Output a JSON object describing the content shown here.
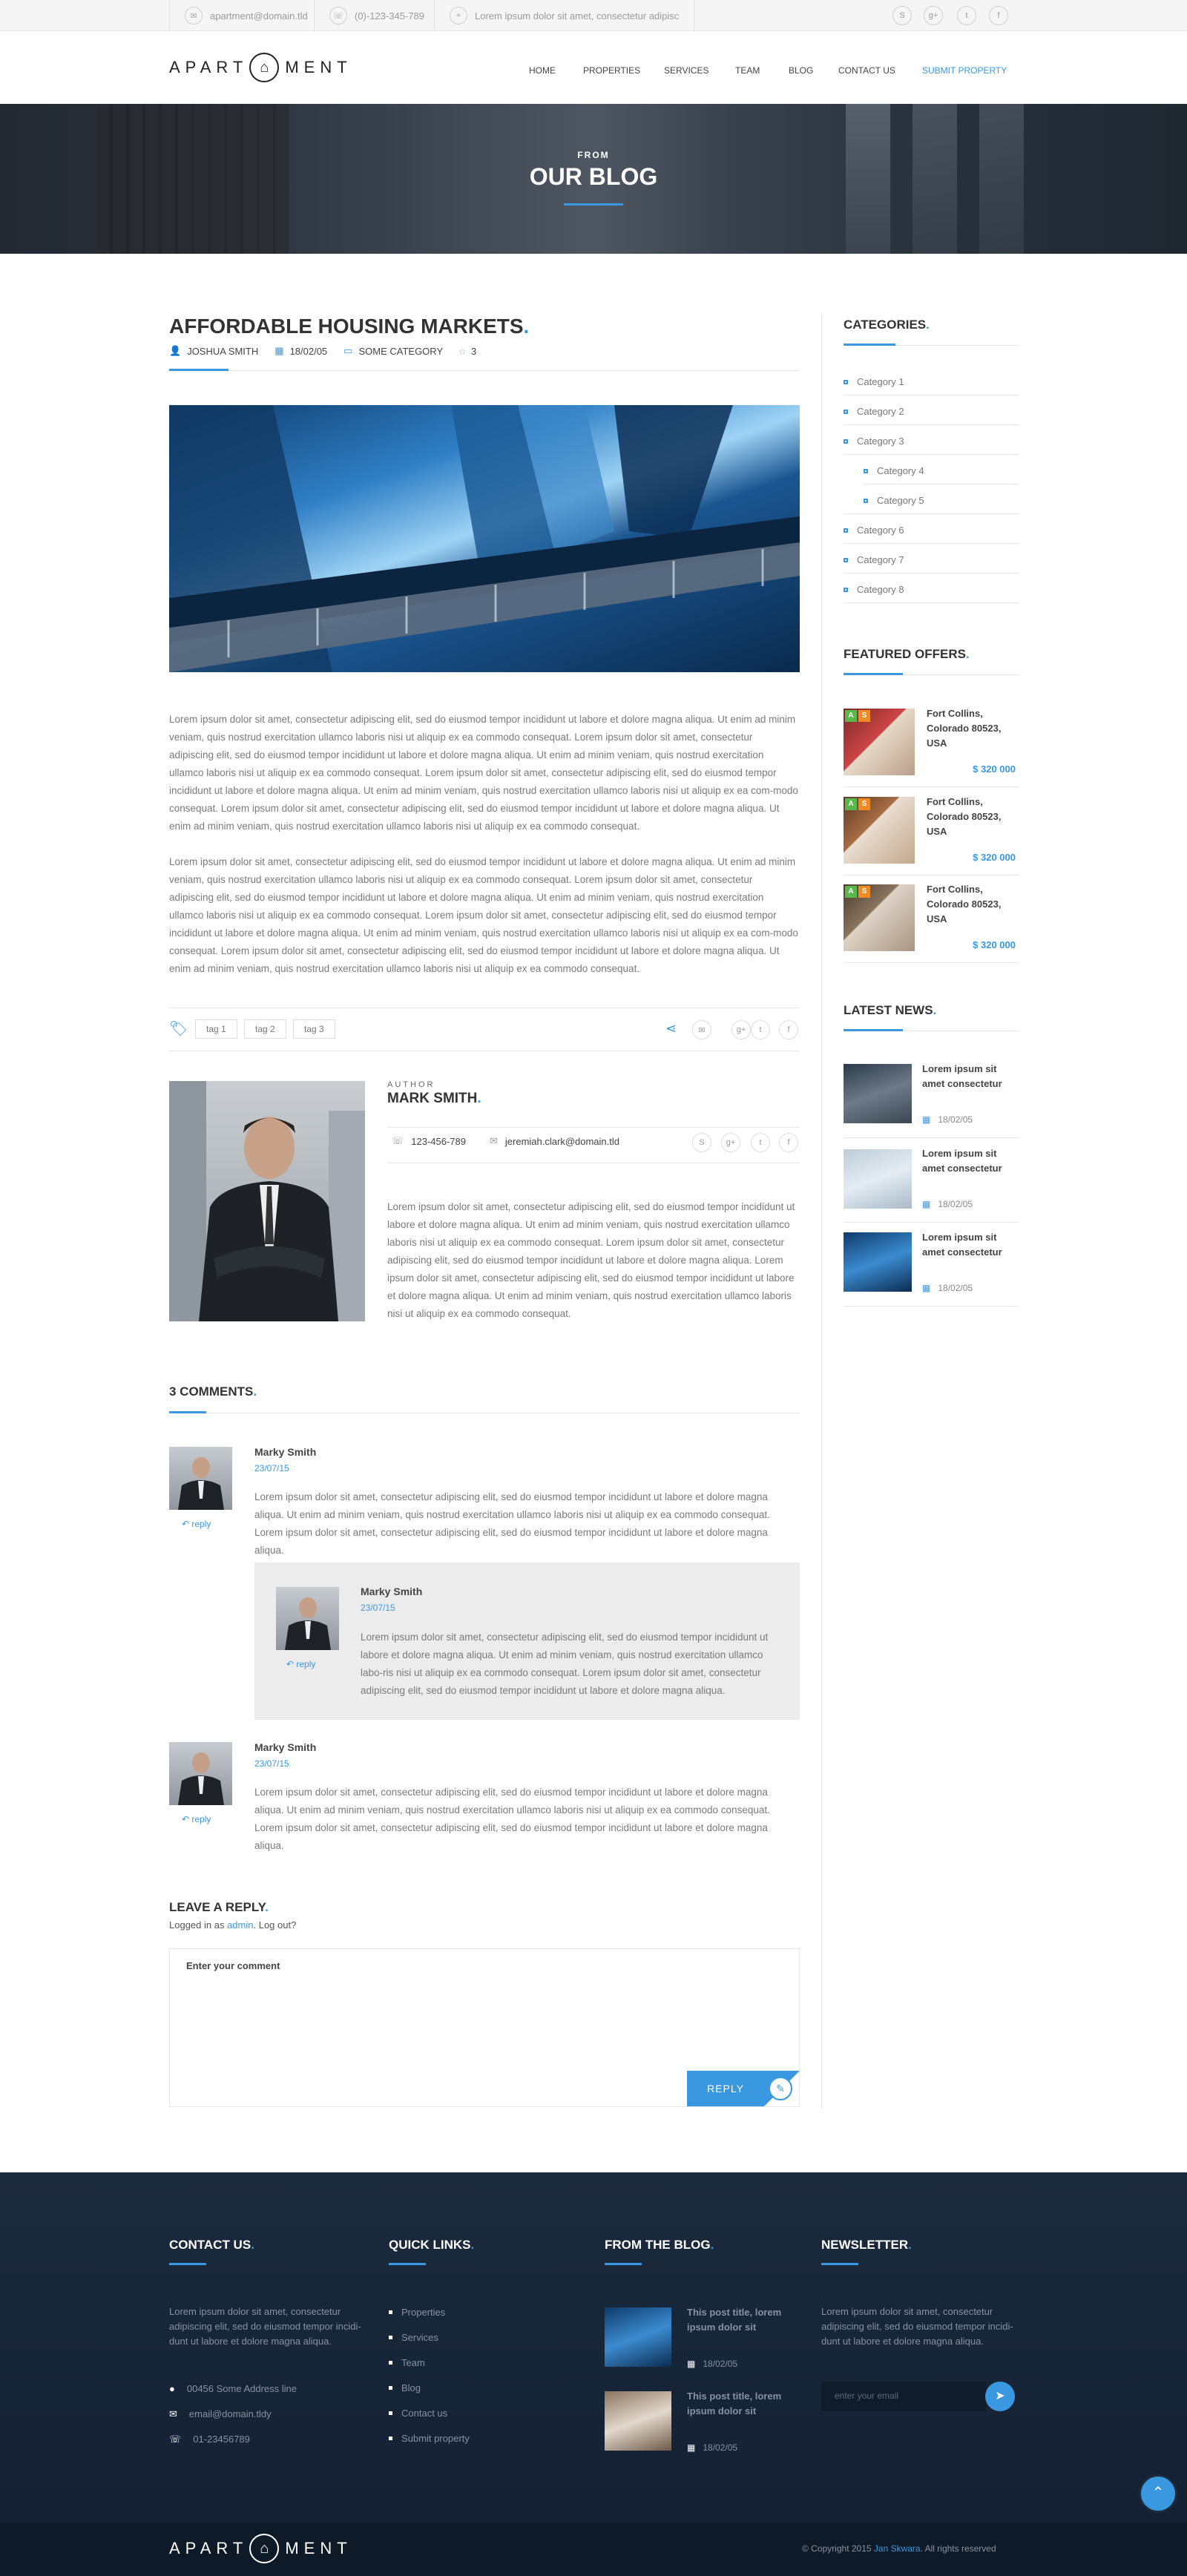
{
  "topbar": {
    "email": "apartment@domain.tld",
    "phone": "(0)-123-345-789",
    "address": "Lorem ipsum dolor sit amet, consectetur adipisc",
    "social": [
      "skype",
      "g+",
      "twitter",
      "f"
    ]
  },
  "header": {
    "logo_left": "APART",
    "logo_right": "MENT",
    "nav": [
      "HOME",
      "PROPERTIES",
      "SERVICES",
      "TEAM",
      "BLOG",
      "CONTACT US",
      "SUBMIT PROPERTY"
    ]
  },
  "hero": {
    "subtitle": "FROM",
    "title": "OUR BLOG"
  },
  "post": {
    "title": "AFFORDABLE HOUSING MARKETS",
    "title_dot": ".",
    "author": "JOSHUA SMITH",
    "date": "18/02/05",
    "category": "SOME CATEGORY",
    "comments": "3",
    "paragraph1": "Lorem ipsum dolor sit amet, consectetur adipiscing elit, sed do eiusmod tempor incididunt ut labore et dolore magna aliqua. Ut enim ad minim veniam, quis nostrud exercitation ullamco laboris nisi ut aliquip ex ea commodo consequat. Lorem ipsum dolor sit amet, consectetur adipiscing elit, sed do eiusmod tempor incididunt ut labore et dolore magna aliqua. Ut enim ad minim veniam, quis nostrud exercitation ullamco laboris nisi ut aliquip ex ea commodo consequat. Lorem ipsum dolor sit amet, consectetur adipiscing elit, sed do eiusmod tempor incididunt ut labore et dolore magna aliqua. Ut enim ad minim veniam, quis nostrud exercitation ullamco laboris nisi ut aliquip ex ea com-modo consequat. Lorem ipsum dolor sit amet, consectetur adipiscing elit, sed do eiusmod tempor incididunt ut labore et dolore magna aliqua. Ut enim ad minim veniam, quis nostrud exercitation ullamco laboris nisi ut aliquip ex ea commodo consequat.",
    "paragraph2": "Lorem ipsum dolor sit amet, consectetur adipiscing elit, sed do eiusmod tempor incididunt ut labore et dolore magna aliqua. Ut enim ad minim veniam, quis nostrud exercitation ullamco laboris nisi ut aliquip ex ea commodo consequat. Lorem ipsum dolor sit amet, consectetur adipiscing elit, sed do eiusmod tempor incididunt ut labore et dolore magna aliqua. Ut enim ad minim veniam, quis nostrud exercitation ullamco laboris nisi ut aliquip ex ea commodo consequat. Lorem ipsum dolor sit amet, consectetur adipiscing elit, sed do eiusmod tempor incididunt ut labore et dolore magna aliqua. Ut enim ad minim veniam, quis nostrud exercitation ullamco laboris nisi ut aliquip ex ea com-modo consequat. Lorem ipsum dolor sit amet, consectetur adipiscing elit, sed do eiusmod tempor incididunt ut labore et dolore magna aliqua. Ut enim ad minim veniam, quis nostrud exercitation ullamco laboris nisi ut aliquip ex ea commodo consequat.",
    "tags": [
      "tag 1",
      "tag 2",
      "tag 3"
    ],
    "share": [
      "share",
      "email",
      "g+",
      "twitter",
      "f"
    ]
  },
  "author": {
    "label": "AUTHOR",
    "name": "MARK SMITH",
    "name_dot": ".",
    "phone": "123-456-789",
    "email": "jeremiah.clark@domain.tld",
    "social": [
      "skype",
      "g+",
      "twitter",
      "f"
    ],
    "bio": "Lorem ipsum dolor sit amet, consectetur adipiscing elit, sed do eiusmod tempor incididunt ut labore et dolore magna aliqua. Ut enim ad minim veniam, quis nostrud exercitation ullamco laboris nisi ut aliquip ex ea commodo consequat. Lorem ipsum dolor sit amet, consectetur adipiscing elit, sed do eiusmod tempor incididunt ut labore et dolore magna aliqua. Lorem ipsum dolor sit amet, consectetur adipiscing elit, sed do eiusmod tempor incididunt ut labore et dolore magna aliqua. Ut enim ad minim veniam, quis nostrud exercitation ullamco laboris nisi ut aliquip ex ea commodo consequat."
  },
  "comments": {
    "title": "3 COMMENTS",
    "title_dot": ".",
    "items": [
      {
        "name": "Marky Smith",
        "date": "23/07/15",
        "reply": "reply",
        "text": "Lorem ipsum dolor sit amet, consectetur adipiscing elit, sed do eiusmod tempor incididunt ut labore et dolore magna aliqua. Ut enim ad minim veniam, quis nostrud exercitation ullamco laboris nisi ut aliquip ex ea commodo consequat. Lorem ipsum dolor sit amet, consectetur adipiscing elit, sed do eiusmod tempor incididunt ut labore et dolore magna aliqua."
      },
      {
        "name": "Marky Smith",
        "date": "23/07/15",
        "reply": "reply",
        "text": "Lorem ipsum dolor sit amet, consectetur adipiscing elit, sed do eiusmod tempor incididunt ut labore et dolore magna aliqua. Ut enim ad minim veniam, quis nostrud exercitation ullamco labo-ris nisi ut aliquip ex ea commodo consequat. Lorem ipsum dolor sit amet, consectetur adipiscing elit, sed do eiusmod tempor incididunt ut labore et dolore magna aliqua."
      },
      {
        "name": "Marky Smith",
        "date": "23/07/15",
        "reply": "reply",
        "text": "Lorem ipsum dolor sit amet, consectetur adipiscing elit, sed do eiusmod tempor incididunt ut labore et dolore magna aliqua. Ut enim ad minim veniam, quis nostrud exercitation ullamco laboris nisi ut aliquip ex ea commodo consequat. Lorem ipsum dolor sit amet, consectetur adipiscing elit, sed do eiusmod tempor incididunt ut labore et dolore magna aliqua."
      }
    ]
  },
  "reply_form": {
    "title": "LEAVE A REPLY",
    "title_dot": ".",
    "logged_prefix": "Logged in as",
    "logged_user": "admin",
    "logged_suffix": ". Log out?",
    "placeholder": "Enter your comment",
    "button": "REPLY"
  },
  "sidebar": {
    "categories_title": "CATEGORIES",
    "categories": [
      "Category 1",
      "Category 2",
      "Category 3",
      "Category 4",
      "Category 5",
      "Category 6",
      "Category 7",
      "Category 8"
    ],
    "featured_title": "FEATURED OFFERS",
    "offers": [
      {
        "location": "Fort Collins, Colorado 80523, USA",
        "price": "$ 320 000"
      },
      {
        "location": "Fort Collins, Colorado 80523, USA",
        "price": "$ 320 000"
      },
      {
        "location": "Fort Collins, Colorado 80523, USA",
        "price": "$ 320 000"
      }
    ],
    "badge_a": "A",
    "badge_s": "S",
    "news_title": "LATEST NEWS",
    "news": [
      {
        "title": "Lorem ipsum sit amet consectetur",
        "date": "18/02/05"
      },
      {
        "title": "Lorem ipsum sit amet consectetur",
        "date": "18/02/05"
      },
      {
        "title": "Lorem ipsum sit amet consectetur",
        "date": "18/02/05"
      }
    ]
  },
  "footer": {
    "contact_title": "CONTACT US",
    "contact_text": "Lorem ipsum dolor sit amet, consectetur adipiscing elit, sed do eiusmod tempor incidi-dunt ut labore et dolore magna aliqua.",
    "address": "00456 Some Address line",
    "email": "email@domain.tldy",
    "phone": "01-23456789",
    "links_title": "QUICK LINKS",
    "links": [
      "Properties",
      "Services",
      "Team",
      "Blog",
      "Contact us",
      "Submit property"
    ],
    "blog_title": "FROM THE BLOG",
    "blog": [
      {
        "title": "This post title, lorem ipsum dolor sit",
        "date": "18/02/05"
      },
      {
        "title": "This post title, lorem ipsum dolor sit",
        "date": "18/02/05"
      }
    ],
    "newsletter_title": "NEWSLETTER",
    "newsletter_text": "Lorem ipsum dolor sit amet, consectetur adipiscing elit, sed do eiusmod tempor incidi-dunt ut labore et dolore magna aliqua.",
    "newsletter_placeholder": "enter your email",
    "copyright_prefix": "© Copyright 2015",
    "copyright_author": "Jan Skwara",
    "copyright_suffix": ". All rights reserved",
    "logo_left": "APART",
    "logo_right": "MENT"
  },
  "colors": {
    "accent": "#3a98e0",
    "footer_bg": "#172538",
    "footer_bottom": "#0f1a29",
    "badge_a": "#59b84a",
    "badge_s": "#f08b24"
  }
}
